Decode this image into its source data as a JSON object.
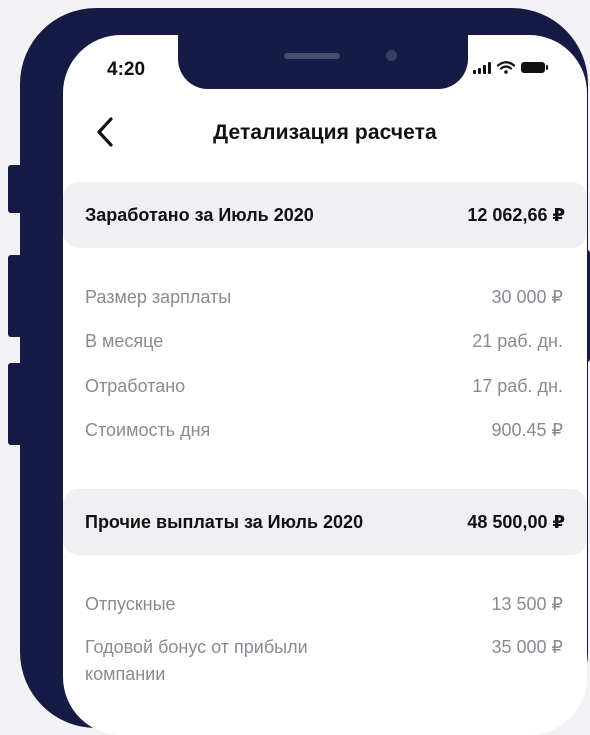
{
  "status_bar": {
    "time": "4:20"
  },
  "nav": {
    "title": "Детализация расчета"
  },
  "earned": {
    "title": "Заработано за Июль 2020",
    "amount": "12 062,66 ₽",
    "rows": [
      {
        "label": "Размер зарплаты",
        "value": "30 000 ₽"
      },
      {
        "label": "В месяце",
        "value": "21 раб. дн."
      },
      {
        "label": "Отработано",
        "value": "17 раб. дн."
      },
      {
        "label": "Стоимость дня",
        "value": "900.45 ₽"
      }
    ]
  },
  "other": {
    "title": "Прочие выплаты за Июль 2020",
    "amount": "48 500,00 ₽",
    "rows": [
      {
        "label": "Отпускные",
        "value": "13 500 ₽"
      },
      {
        "label": "Годовой бонус от прибыли компании",
        "value": "35 000 ₽"
      }
    ]
  },
  "colors": {
    "frame": "#161b45",
    "section_bg": "#efeff4",
    "muted_text": "#8a8a93"
  }
}
